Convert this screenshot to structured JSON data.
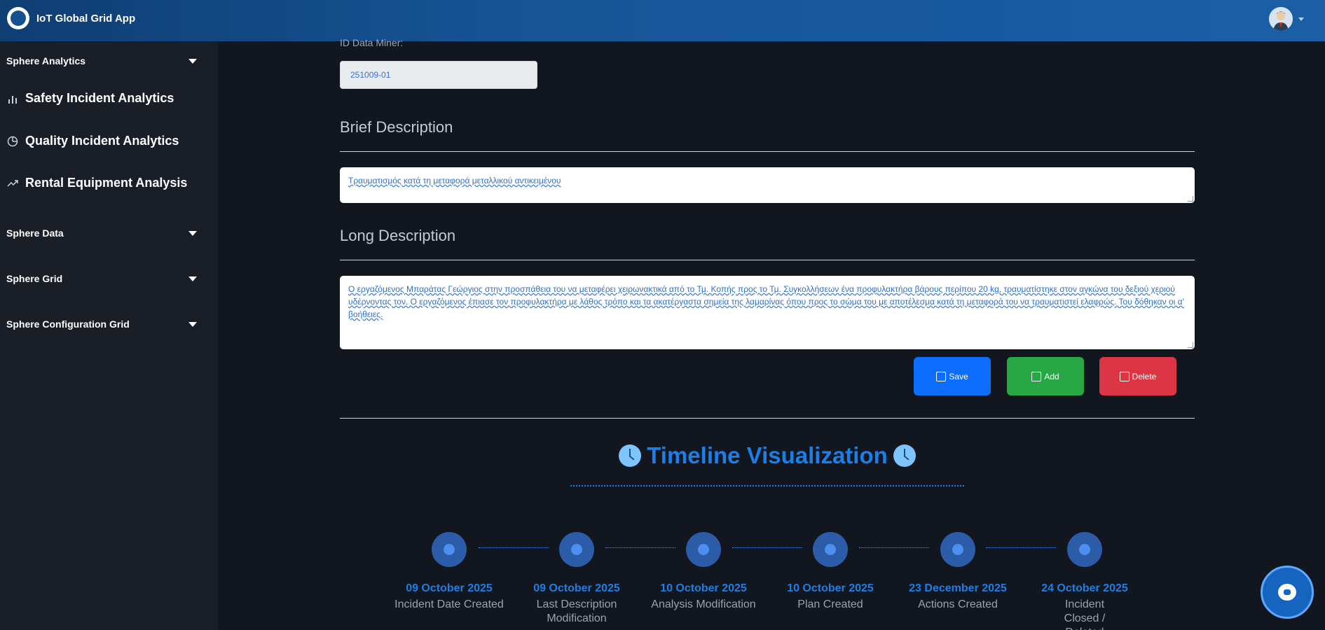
{
  "header": {
    "app_name": "IoT Global Grid App"
  },
  "sidebar": {
    "sections": [
      {
        "label": "Sphere Analytics"
      },
      {
        "label": "Sphere Data"
      },
      {
        "label": "Sphere Grid"
      },
      {
        "label": "Sphere Configuration Grid"
      }
    ],
    "analytics_items": [
      {
        "label": "Safety Incident Analytics",
        "icon": "bar-chart-icon"
      },
      {
        "label": "Quality Incident Analytics",
        "icon": "pie-chart-icon"
      },
      {
        "label": "Rental Equipment Analysis",
        "icon": "trend-up-icon"
      }
    ]
  },
  "form": {
    "id_label": "ID Data Miner:",
    "id_value": "251009-01",
    "brief_title": "Brief Description",
    "brief_text": "Τραυματισμός κατά τη μεταφορά μεταλλικού αντικειμένου",
    "long_title": "Long Description",
    "long_text": "Ο εργαζόμενος Μπαράτας Γεώργιος στην προσπάθεια του να μεταφέρει χειρωνακτικά από το Τμ. Κοπής προς το Τμ. Συγκολλήσεων ένα προφυλακτήρα βάρους περίπου 20 kg, τραυματίστηκε στον αγκώνα του δεξιού χεριού υδέρνοντας τον. Ο εργαζόμενος έπιασε τον προφυλακτήρα με λάθος τρόπο και τα ακατέργαστα σημεία της λαμαρίνας όπου προς το σώμα του με αποτέλεσμα κατά τη μεταφορά του να τραυματιστεί ελαφρώς. Του δόθηκαν οι α' βοήθειες."
  },
  "buttons": {
    "save": "Save",
    "add": "Add",
    "delete": "Delete"
  },
  "timeline": {
    "title": "Timeline Visualization",
    "events": [
      {
        "date": "09 October 2025",
        "caption": "Incident Date Created"
      },
      {
        "date": "09 October 2025",
        "caption": "Last Description Modification"
      },
      {
        "date": "10 October 2025",
        "caption": "Analysis Modification"
      },
      {
        "date": "10 October 2025",
        "caption": "Plan Created"
      },
      {
        "date": "23 December 2025",
        "caption": "Actions Created"
      },
      {
        "date": "24 October 2025",
        "caption": "Incident Closed / Deleted"
      }
    ]
  },
  "colors": {
    "accent": "#1a7fe8",
    "save": "#0d6efd",
    "add": "#28a745",
    "delete": "#dc3545"
  }
}
